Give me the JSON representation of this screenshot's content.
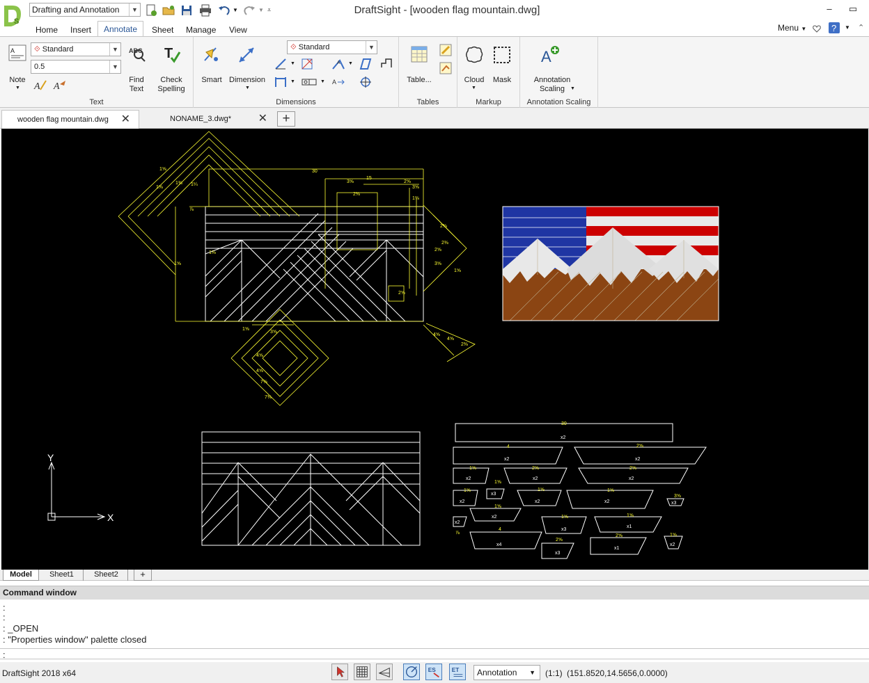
{
  "window": {
    "title": "DraftSight - [wooden flag mountain.dwg]",
    "workspace": "Drafting and Annotation",
    "minimize": "–",
    "restore": "▭"
  },
  "ribbon_tabs": [
    "Home",
    "Insert",
    "Annotate",
    "Sheet",
    "Manage",
    "View"
  ],
  "menu": {
    "label": "Menu",
    "arrow": "▼"
  },
  "text_group": {
    "label": "Text",
    "style_combo": "Standard",
    "height_combo": "0.5",
    "note": "Note",
    "find_text": "Find Text",
    "check_spelling": "Check Spelling"
  },
  "dimensions_group": {
    "label": "Dimensions",
    "smart": "Smart",
    "dimension": "Dimension",
    "style_combo": "Standard"
  },
  "tables_group": {
    "label": "Tables",
    "table": "Table..."
  },
  "markup_group": {
    "label": "Markup",
    "cloud": "Cloud",
    "mask": "Mask"
  },
  "annotation_scaling_group": {
    "label": "Annotation Scaling",
    "button": "Annotation Scaling"
  },
  "doc_tabs": [
    {
      "name": "wooden flag mountain.dwg"
    },
    {
      "name": "NONAME_3.dwg*"
    }
  ],
  "sheet_tabs": [
    "Model",
    "Sheet1",
    "Sheet2"
  ],
  "drawing": {
    "dim_labels": [
      "30",
      "15",
      "x2",
      "x3",
      "x4",
      "x1"
    ],
    "axis_x": "X",
    "axis_y": "Y",
    "flag_colors": {
      "blue": "#1f35a3",
      "red": "#cc0000",
      "white": "#e0e0e0",
      "snow": "#dcdcdc",
      "wood": "#8b4513",
      "line": "#ffff33"
    }
  },
  "command_window": {
    "title": "Command window",
    "lines": [
      ":",
      ":",
      ": _OPEN",
      ": \"Properties window\" palette closed",
      ":"
    ]
  },
  "status": {
    "product": "DraftSight 2018 x64",
    "annotation": "Annotation",
    "scale": "(1:1)",
    "coords": "(151.8520,14.5656,0.0000)"
  }
}
